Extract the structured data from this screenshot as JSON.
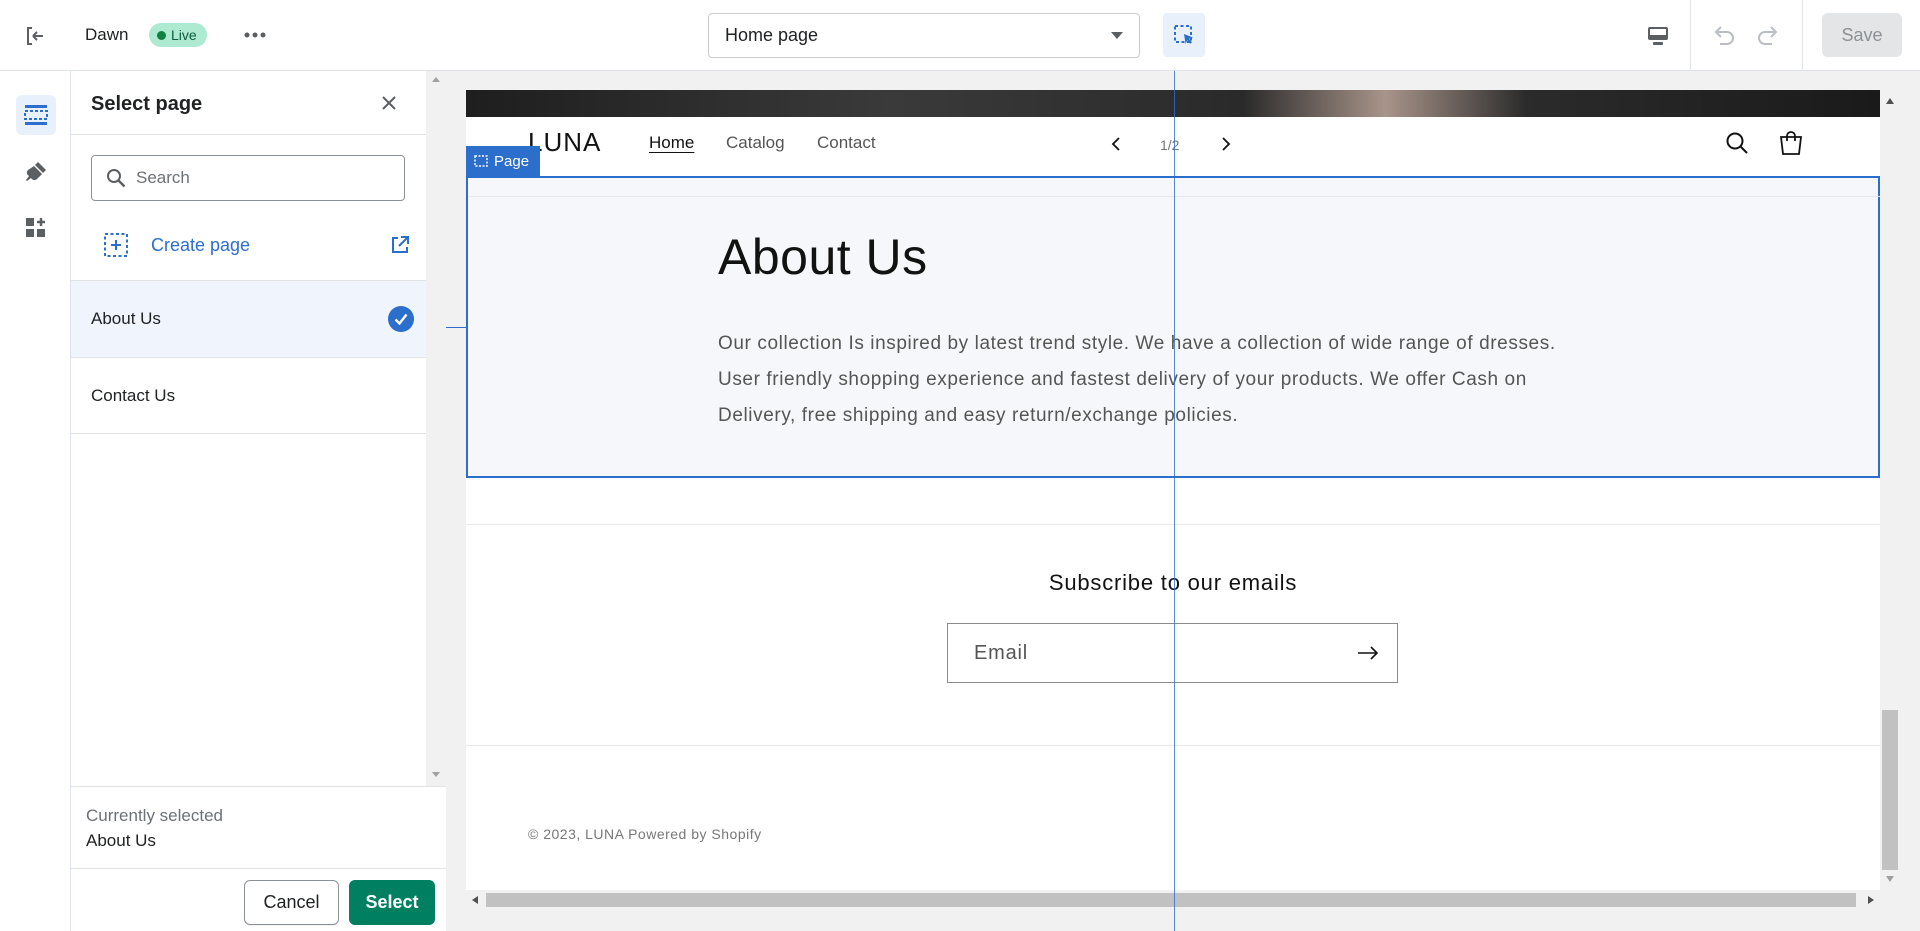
{
  "topbar": {
    "theme_name": "Dawn",
    "live_badge": "Live",
    "page_selector_value": "Home page",
    "save_label": "Save"
  },
  "panel": {
    "title": "Select page",
    "search_placeholder": "Search",
    "create_label": "Create page",
    "items": [
      {
        "label": "About Us",
        "selected": true
      },
      {
        "label": "Contact Us",
        "selected": false
      }
    ],
    "currently_selected_label": "Currently selected",
    "currently_selected_value": "About Us",
    "cancel_label": "Cancel",
    "select_label": "Select"
  },
  "store": {
    "logo": "LUNA",
    "nav": [
      "Home",
      "Catalog",
      "Contact"
    ],
    "pager": "1/2",
    "section_tag": "Page",
    "page_title": "About Us",
    "page_body": "Our collection Is inspired by latest trend style. We have a collection of wide range of dresses. User friendly shopping experience and fastest delivery of your products. We offer Cash on Delivery, free shipping and easy return/exchange policies.",
    "subscribe_title": "Subscribe to our emails",
    "email_placeholder": "Email",
    "copyright": "© 2023, LUNA Powered by Shopify"
  },
  "colors": {
    "accent_blue": "#2c6ecb",
    "primary_green": "#008060",
    "live_badge_bg": "#aee9d1"
  },
  "icons": [
    "exit-icon",
    "more-icon",
    "chevron-down-icon",
    "inspector-icon",
    "desktop-icon",
    "undo-icon",
    "redo-icon",
    "sections-icon",
    "theme-settings-icon",
    "apps-icon",
    "close-icon",
    "search-icon",
    "create-page-icon",
    "external-link-icon",
    "check-icon",
    "chevron-left-icon",
    "chevron-right-icon",
    "cart-icon",
    "arrow-right-icon"
  ]
}
